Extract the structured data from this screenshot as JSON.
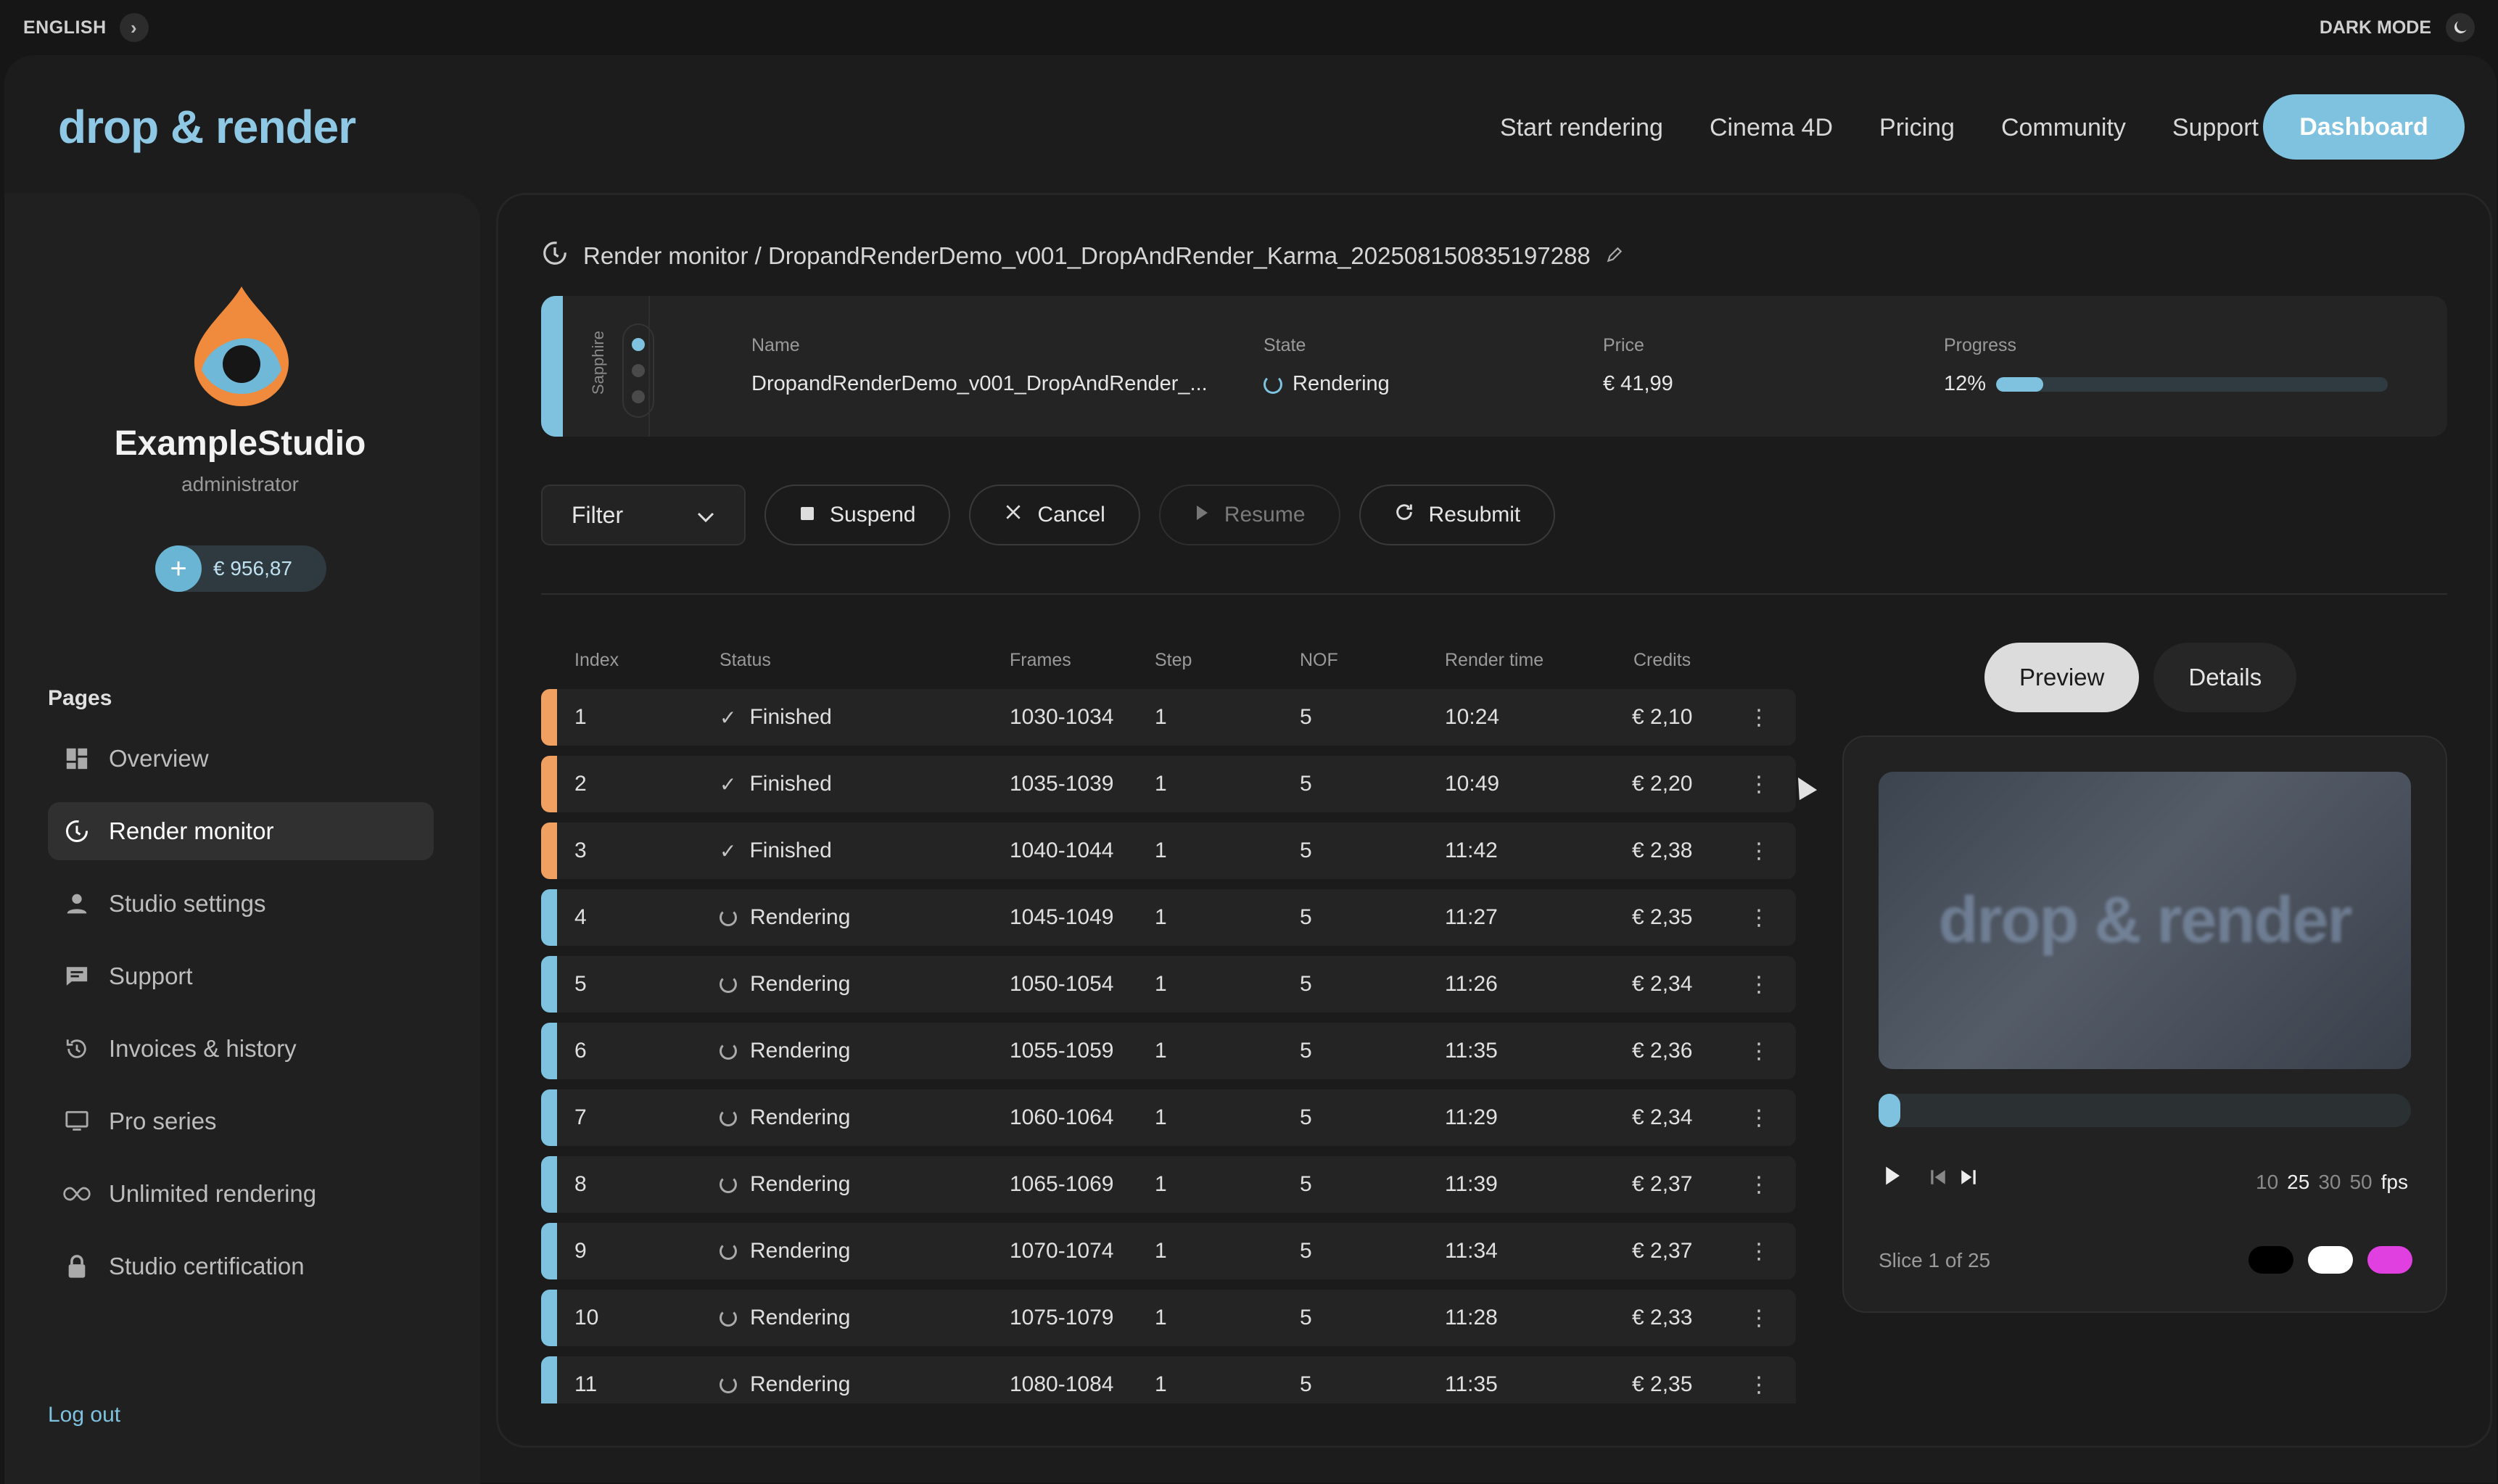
{
  "topbar": {
    "language": "ENGLISH",
    "dark_mode": "DARK MODE"
  },
  "header": {
    "logo": "drop & render",
    "nav": [
      "Start rendering",
      "Cinema 4D",
      "Pricing",
      "Community",
      "Support"
    ],
    "dashboard_button": "Dashboard"
  },
  "sidebar": {
    "studio_name": "ExampleStudio",
    "role": "administrator",
    "credit": "€ 956,87",
    "pages_label": "Pages",
    "items": [
      {
        "label": "Overview",
        "icon": "grid-icon"
      },
      {
        "label": "Render monitor",
        "icon": "render-monitor-icon",
        "active": true
      },
      {
        "label": "Studio settings",
        "icon": "user-icon"
      },
      {
        "label": "Support",
        "icon": "chat-icon"
      },
      {
        "label": "Invoices & history",
        "icon": "history-icon"
      },
      {
        "label": "Pro series",
        "icon": "monitor-icon"
      },
      {
        "label": "Unlimited rendering",
        "icon": "infinity-icon"
      },
      {
        "label": "Studio certification",
        "icon": "lock-icon"
      }
    ],
    "logout": "Log out"
  },
  "breadcrumb": {
    "text": "Render monitor / DropandRenderDemo_v001_DropAndRender_Karma_202508150835197288"
  },
  "job": {
    "tag": "Sapphire",
    "name_label": "Name",
    "name": "DropandRenderDemo_v001_DropAndRender_...",
    "state_label": "State",
    "state": "Rendering",
    "price_label": "Price",
    "price": "€ 41,99",
    "progress_label": "Progress",
    "progress_text": "12%",
    "progress": 0.12
  },
  "toolbar": {
    "filter": "Filter",
    "suspend": "Suspend",
    "cancel": "Cancel",
    "resume": "Resume",
    "resubmit": "Resubmit"
  },
  "table": {
    "columns": [
      "Index",
      "Status",
      "Frames",
      "Step",
      "NOF",
      "Render time",
      "Credits"
    ],
    "rows": [
      {
        "index": "1",
        "status": "Finished",
        "frames": "1030-1034",
        "step": "1",
        "nof": "5",
        "time": "10:24",
        "credits": "€ 2,10"
      },
      {
        "index": "2",
        "status": "Finished",
        "frames": "1035-1039",
        "step": "1",
        "nof": "5",
        "time": "10:49",
        "credits": "€ 2,20"
      },
      {
        "index": "3",
        "status": "Finished",
        "frames": "1040-1044",
        "step": "1",
        "nof": "5",
        "time": "11:42",
        "credits": "€ 2,38"
      },
      {
        "index": "4",
        "status": "Rendering",
        "frames": "1045-1049",
        "step": "1",
        "nof": "5",
        "time": "11:27",
        "credits": "€ 2,35"
      },
      {
        "index": "5",
        "status": "Rendering",
        "frames": "1050-1054",
        "step": "1",
        "nof": "5",
        "time": "11:26",
        "credits": "€ 2,34"
      },
      {
        "index": "6",
        "status": "Rendering",
        "frames": "1055-1059",
        "step": "1",
        "nof": "5",
        "time": "11:35",
        "credits": "€ 2,36"
      },
      {
        "index": "7",
        "status": "Rendering",
        "frames": "1060-1064",
        "step": "1",
        "nof": "5",
        "time": "11:29",
        "credits": "€ 2,34"
      },
      {
        "index": "8",
        "status": "Rendering",
        "frames": "1065-1069",
        "step": "1",
        "nof": "5",
        "time": "11:39",
        "credits": "€ 2,37"
      },
      {
        "index": "9",
        "status": "Rendering",
        "frames": "1070-1074",
        "step": "1",
        "nof": "5",
        "time": "11:34",
        "credits": "€ 2,37"
      },
      {
        "index": "10",
        "status": "Rendering",
        "frames": "1075-1079",
        "step": "1",
        "nof": "5",
        "time": "11:28",
        "credits": "€ 2,33"
      },
      {
        "index": "11",
        "status": "Rendering",
        "frames": "1080-1084",
        "step": "1",
        "nof": "5",
        "time": "11:35",
        "credits": "€ 2,35"
      }
    ]
  },
  "preview": {
    "tabs": [
      "Preview",
      "Details"
    ],
    "image_text": "drop & render",
    "fps_options": [
      "10",
      "25",
      "30",
      "50"
    ],
    "fps_selected": "25",
    "fps_unit": "fps",
    "slice": "Slice 1 of 25",
    "swatches": [
      "#000000",
      "#ffffff",
      "#e040e0"
    ]
  },
  "colors": {
    "accent": "#7fc2df",
    "finished_stripe": "#f0a060",
    "rendering_stripe": "#7fc2df"
  }
}
